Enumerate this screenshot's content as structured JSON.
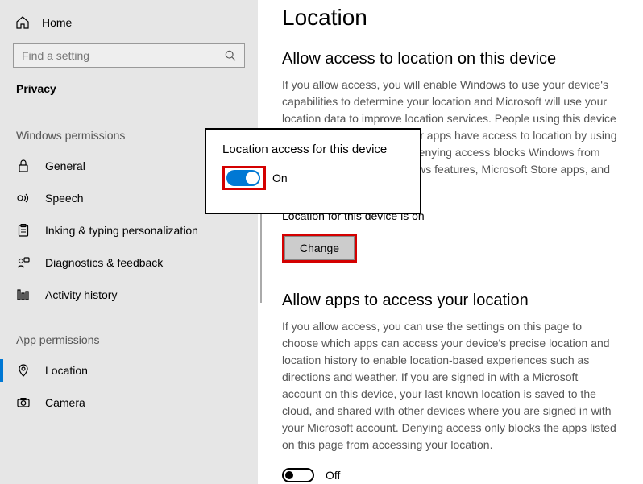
{
  "sidebar": {
    "home": "Home",
    "search_placeholder": "Find a setting",
    "category": "Privacy",
    "group1_label": "Windows permissions",
    "group1": [
      {
        "label": "General"
      },
      {
        "label": "Speech"
      },
      {
        "label": "Inking & typing personalization"
      },
      {
        "label": "Diagnostics & feedback"
      },
      {
        "label": "Activity history"
      }
    ],
    "group2_label": "App permissions",
    "group2": [
      {
        "label": "Location"
      },
      {
        "label": "Camera"
      }
    ]
  },
  "main": {
    "title": "Location",
    "section1_title": "Allow access to location on this device",
    "section1_body": "If you allow access, you will enable Windows to use your device's capabilities to determine your location and Microsoft will use your location data to improve location services. People using this device will be able to choose if their apps have access to location by using the settings on this page. Denying access blocks Windows from providing location to Windows features, Microsoft Store apps, and most desktop apps.",
    "status_line": "Location for this device is on",
    "change_btn": "Change",
    "section2_title": "Allow apps to access your location",
    "section2_body": "If you allow access, you can use the settings on this page to choose which apps can access your device's precise location and location history to enable location-based experiences such as directions and weather. If you are signed in with a Microsoft account on this device, your last known location is saved to the cloud, and shared with other devices where you are signed in with your Microsoft account. Denying access only blocks the apps listed on this page from accessing your location.",
    "toggle2_label": "Off"
  },
  "popup": {
    "title": "Location access for this device",
    "toggle_label": "On"
  }
}
